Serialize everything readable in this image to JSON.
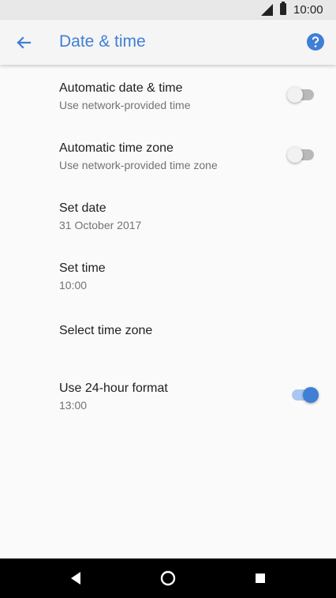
{
  "status_bar": {
    "time": "10:00"
  },
  "app_bar": {
    "title": "Date & time"
  },
  "settings": [
    {
      "title": "Automatic date & time",
      "summary": "Use network-provided time",
      "toggle": "off"
    },
    {
      "title": "Automatic time zone",
      "summary": "Use network-provided time zone",
      "toggle": "off"
    },
    {
      "title": "Set date",
      "summary": "31 October 2017"
    },
    {
      "title": "Set time",
      "summary": "10:00"
    },
    {
      "title": "Select time zone"
    },
    {
      "title": "Use 24-hour format",
      "summary": "13:00",
      "toggle": "on"
    }
  ],
  "colors": {
    "accent": "#3f7fd6",
    "nav_bar": "#000000",
    "status_bar": "#e8e8e8"
  },
  "icons": {
    "back": "arrow-back-icon",
    "help": "help-icon",
    "nav_back": "nav-back-icon",
    "nav_home": "nav-home-icon",
    "nav_recents": "nav-recents-icon"
  }
}
